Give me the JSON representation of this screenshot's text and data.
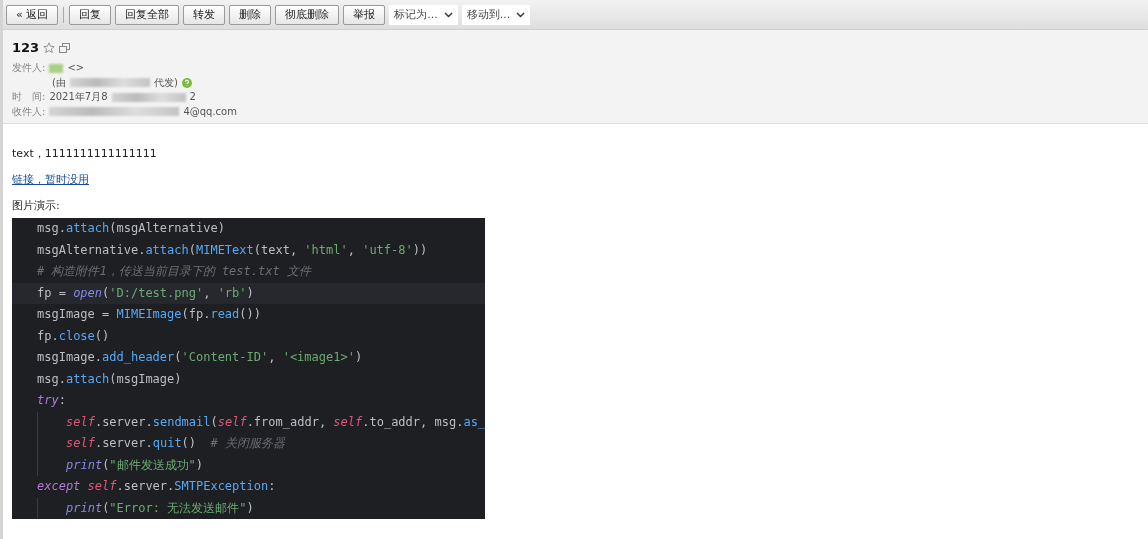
{
  "toolbar": {
    "back": "« 返回",
    "buttons": [
      "回复",
      "回复全部",
      "转发",
      "删除",
      "彻底删除",
      "举报"
    ],
    "dropdowns": [
      "标记为...",
      "移动到..."
    ]
  },
  "mail": {
    "subject": "123",
    "from": {
      "label": "发件人:",
      "name_tail": "<>",
      "via_open": "(由",
      "via_close": "代发)"
    },
    "time": {
      "label": "时　间:",
      "value": "2021年7月8",
      "tail": "2"
    },
    "to": {
      "label": "收件人:",
      "tail": "4@qq.com"
    }
  },
  "body": {
    "text": "text，1111111111111111",
    "link": "链接，暂时没用",
    "caption": "图片演示:"
  },
  "code": [
    {
      "highlighted": false,
      "tokens": [
        {
          "text": "msg.",
          "kind": "plain"
        },
        {
          "text": "attach",
          "kind": "fn"
        },
        {
          "text": "(msgAlternative)",
          "kind": "plain"
        }
      ]
    },
    {
      "highlighted": false,
      "tokens": [
        {
          "text": "msgAlternative.",
          "kind": "plain"
        },
        {
          "text": "attach",
          "kind": "fn"
        },
        {
          "text": "(",
          "kind": "plain"
        },
        {
          "text": "MIMEText",
          "kind": "fn"
        },
        {
          "text": "(text, ",
          "kind": "plain"
        },
        {
          "text": "'html'",
          "kind": "str"
        },
        {
          "text": ", ",
          "kind": "plain"
        },
        {
          "text": "'utf-8'",
          "kind": "str"
        },
        {
          "text": "))",
          "kind": "plain"
        }
      ]
    },
    {
      "highlighted": false,
      "tokens": [
        {
          "text": "# 构造附件1，传送当前目录下的 test.txt 文件",
          "kind": "comment"
        }
      ]
    },
    {
      "highlighted": true,
      "tokens": [
        {
          "text": "fp = ",
          "kind": "plain"
        },
        {
          "text": "open",
          "kind": "builtin"
        },
        {
          "text": "(",
          "kind": "plain"
        },
        {
          "text": "'D:/test.png'",
          "kind": "str"
        },
        {
          "text": ", ",
          "kind": "plain"
        },
        {
          "text": "'rb'",
          "kind": "str"
        },
        {
          "text": ")",
          "kind": "plain"
        }
      ]
    },
    {
      "highlighted": false,
      "tokens": [
        {
          "text": "msgImage = ",
          "kind": "plain"
        },
        {
          "text": "MIMEImage",
          "kind": "fn"
        },
        {
          "text": "(fp.",
          "kind": "plain"
        },
        {
          "text": "read",
          "kind": "fn"
        },
        {
          "text": "())",
          "kind": "plain"
        }
      ]
    },
    {
      "highlighted": false,
      "tokens": [
        {
          "text": "fp.",
          "kind": "plain"
        },
        {
          "text": "close",
          "kind": "fn"
        },
        {
          "text": "()",
          "kind": "plain"
        }
      ]
    },
    {
      "highlighted": false,
      "tokens": [
        {
          "text": "msgImage.",
          "kind": "plain"
        },
        {
          "text": "add_header",
          "kind": "fn"
        },
        {
          "text": "(",
          "kind": "plain"
        },
        {
          "text": "'Content-ID'",
          "kind": "str"
        },
        {
          "text": ", ",
          "kind": "plain"
        },
        {
          "text": "'<image1>'",
          "kind": "str"
        },
        {
          "text": ")",
          "kind": "plain"
        }
      ]
    },
    {
      "highlighted": false,
      "tokens": [
        {
          "text": "msg.",
          "kind": "plain"
        },
        {
          "text": "attach",
          "kind": "fn"
        },
        {
          "text": "(msgImage)",
          "kind": "plain"
        }
      ]
    },
    {
      "highlighted": false,
      "tokens": [
        {
          "text": "try",
          "kind": "kw"
        },
        {
          "text": ":",
          "kind": "plain"
        }
      ],
      "children": [
        {
          "highlighted": false,
          "tokens": [
            {
              "text": "self",
              "kind": "self"
            },
            {
              "text": ".server.",
              "kind": "plain"
            },
            {
              "text": "sendmail",
              "kind": "fn"
            },
            {
              "text": "(",
              "kind": "plain"
            },
            {
              "text": "self",
              "kind": "self"
            },
            {
              "text": ".from_addr, ",
              "kind": "plain"
            },
            {
              "text": "self",
              "kind": "self"
            },
            {
              "text": ".to_addr, msg.",
              "kind": "plain"
            },
            {
              "text": "as_",
              "kind": "fn"
            }
          ]
        },
        {
          "highlighted": false,
          "tokens": [
            {
              "text": "self",
              "kind": "self"
            },
            {
              "text": ".server.",
              "kind": "plain"
            },
            {
              "text": "quit",
              "kind": "fn"
            },
            {
              "text": "()  ",
              "kind": "plain"
            },
            {
              "text": "# 关闭服务器",
              "kind": "comment"
            }
          ]
        },
        {
          "highlighted": false,
          "tokens": [
            {
              "text": "print",
              "kind": "builtin"
            },
            {
              "text": "(",
              "kind": "plain"
            },
            {
              "text": "\"邮件发送成功\"",
              "kind": "str"
            },
            {
              "text": ")",
              "kind": "plain"
            }
          ]
        }
      ]
    },
    {
      "highlighted": false,
      "tokens": [
        {
          "text": "except ",
          "kind": "kw"
        },
        {
          "text": "self",
          "kind": "self"
        },
        {
          "text": ".server.",
          "kind": "plain"
        },
        {
          "text": "SMTPException",
          "kind": "fn"
        },
        {
          "text": ":",
          "kind": "plain"
        }
      ],
      "children": [
        {
          "highlighted": false,
          "tokens": [
            {
              "text": "print",
              "kind": "builtin"
            },
            {
              "text": "(",
              "kind": "plain"
            },
            {
              "text": "\"Error: 无法发送邮件\"",
              "kind": "str"
            },
            {
              "text": ")",
              "kind": "plain"
            }
          ]
        }
      ]
    }
  ]
}
